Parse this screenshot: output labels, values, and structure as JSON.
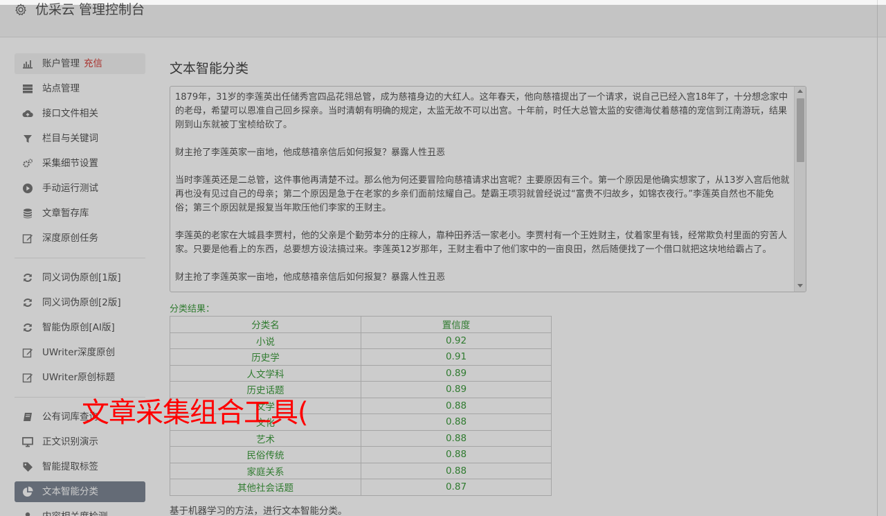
{
  "header": {
    "title": "优采云 管理控制台",
    "icon": "gear-icon"
  },
  "sidebar": {
    "items": [
      {
        "label": "账户管理",
        "badge": "充信",
        "icon": "bar-chart-icon"
      },
      {
        "label": "站点管理",
        "icon": "server-icon"
      },
      {
        "label": "接口文件相关",
        "icon": "cloud-upload-icon"
      },
      {
        "label": "栏目与关键词",
        "icon": "filter-icon"
      },
      {
        "label": "采集细节设置",
        "icon": "cogs-icon"
      },
      {
        "label": "手动运行测试",
        "icon": "play-circle-icon"
      },
      {
        "label": "文章暂存库",
        "icon": "database-icon"
      },
      {
        "label": "深度原创任务",
        "icon": "edit-icon"
      },
      {
        "label": "同义词伪原创[1版]",
        "icon": "refresh-icon"
      },
      {
        "label": "同义词伪原创[2版]",
        "icon": "refresh-icon"
      },
      {
        "label": "智能伪原创[AI版]",
        "icon": "refresh-icon"
      },
      {
        "label": "UWriter深度原创",
        "icon": "edit-icon"
      },
      {
        "label": "UWriter原创标题",
        "icon": "edit-icon"
      },
      {
        "label": "公有词库查询",
        "icon": "book-icon"
      },
      {
        "label": "正文识别演示",
        "icon": "monitor-icon"
      },
      {
        "label": "智能提取标签",
        "icon": "tag-icon"
      },
      {
        "label": "文本智能分类",
        "icon": "pie-chart-icon"
      },
      {
        "label": "内容相关度检测",
        "icon": "user-icon"
      }
    ]
  },
  "main": {
    "title": "文本智能分类",
    "text_paragraphs": [
      "1879年，31岁的李莲英出任储秀宫四品花翎总管，成为慈禧身边的大红人。这年春天，他向慈禧提出了一个请求，说自己已经入宫18年了，十分想念家中的老母，希望可以恩准自己回乡探亲。当时清朝有明确的规定，太监无故不可以出宫。十年前，时任大总管太监的安德海仗着慈禧的宠信到江南游玩，结果刚到山东就被丁宝桢给砍了。",
      "财主抢了李莲英家一亩地，他成慈禧亲信后如何报复？暴露人性丑恶",
      "当时李莲英还是二总管，这件事他再清楚不过。那么他为何还要冒险向慈禧请求出宫呢？主要原因有三个。第一个原因是他确实想家了，从13岁入宫后他就再也没有见过自己的母亲；第二个原因是急于在老家的乡亲们面前炫耀自己。楚霸王项羽就曾经说过“富贵不归故乡，如锦衣夜行。”李莲英自然也不能免俗；第三个原因就是报复当年欺压他们李家的王财主。",
      "李莲英的老家在大城县李贾村，他的父亲是个勤劳本分的庄稼人，靠种田养活一家老小。李贾村有一个王姓财主，仗着家里有钱，经常欺负村里面的穷苦人家。只要是他看上的东西，总要想方设法搞过来。李莲英12岁那年，王财主看中了他们家中的一亩良田，然后随便找了一个借口就把这块地给霸占了。",
      "财主抢了李莲英家一亩地，他成慈禧亲信后如何报复？暴露人性丑恶"
    ],
    "result_label": "分类结果：",
    "table": {
      "headers": [
        "分类名",
        "置信度"
      ],
      "rows": [
        [
          "小说",
          "0.92"
        ],
        [
          "历史学",
          "0.91"
        ],
        [
          "人文学科",
          "0.89"
        ],
        [
          "历史话题",
          "0.89"
        ],
        [
          "文学",
          "0.88"
        ],
        [
          "文化",
          "0.88"
        ],
        [
          "艺术",
          "0.88"
        ],
        [
          "民俗传统",
          "0.88"
        ],
        [
          "家庭关系",
          "0.88"
        ],
        [
          "其他社会话题",
          "0.87"
        ]
      ]
    },
    "footer_note": "基于机器学习的方法，进行文本智能分类。"
  },
  "watermark": "文章采集组合工具(",
  "colors": {
    "accent_green": "#3c9a3c",
    "active_nav": "#7d8694",
    "badge_red": "#d43f3a",
    "watermark_red": "#ff0000"
  }
}
